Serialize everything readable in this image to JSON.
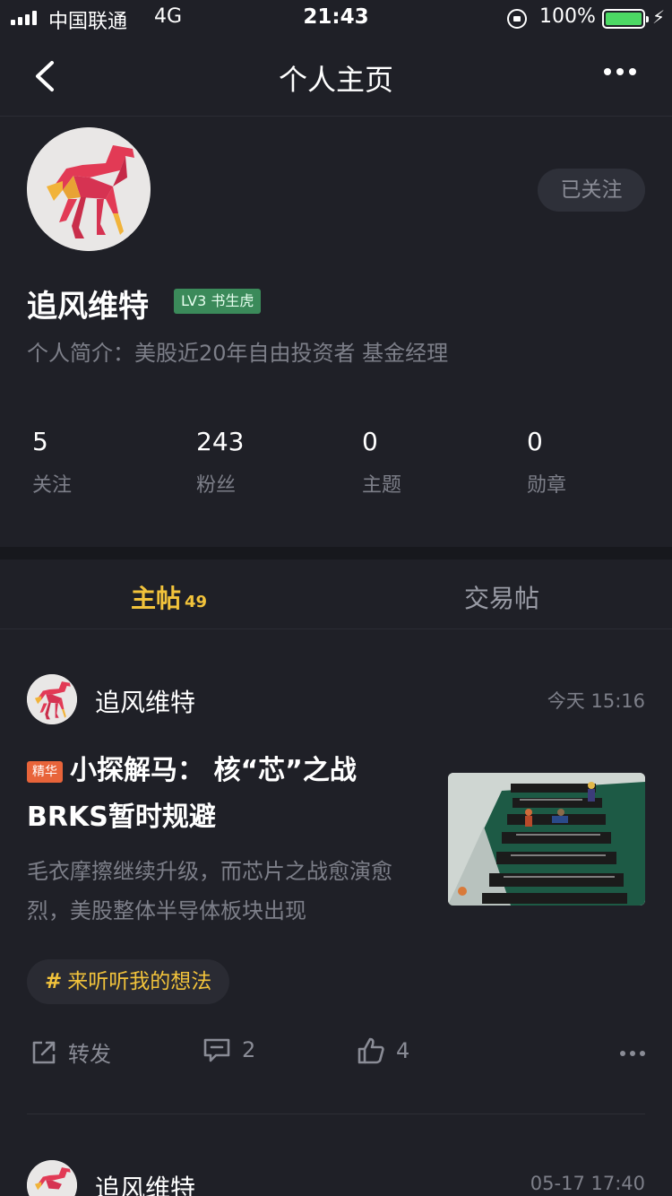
{
  "status_bar": {
    "carrier": "中国联通",
    "network": "4G",
    "time": "21:43",
    "battery_percent": "100%",
    "battery_color": "#4cd964"
  },
  "nav": {
    "title": "个人主页",
    "back_icon": "chevron-left-icon",
    "more_icon": "more-horizontal-icon"
  },
  "profile": {
    "name": "追风维特",
    "level": "LV3 书生虎",
    "bio": "个人简介：美股近20年自由投资者  基金经理",
    "follow_status": "已关注",
    "stats": [
      {
        "value": "5",
        "label": "关注"
      },
      {
        "value": "243",
        "label": "粉丝"
      },
      {
        "value": "0",
        "label": "主题"
      },
      {
        "value": "0",
        "label": "勋章"
      }
    ]
  },
  "tabs": {
    "main_label": "主帖",
    "main_count": "49",
    "trade_label": "交易帖",
    "active_color": "#f2c33b"
  },
  "posts": [
    {
      "author": "追风维特",
      "time": "今天 15:16",
      "badge": "精华",
      "title": "小探解马：  核“芯”之战BRKS暂时规避",
      "excerpt": "毛衣摩擦继续升级，而芯片之战愈演愈烈，美股整体半导体板块出现",
      "topic_hash": "#",
      "topic": "来听听我的想法",
      "actions": {
        "share_label": "转发",
        "comment_count": "2",
        "like_count": "4"
      }
    },
    {
      "author": "追风维特",
      "time": "05-17 17:40"
    }
  ]
}
